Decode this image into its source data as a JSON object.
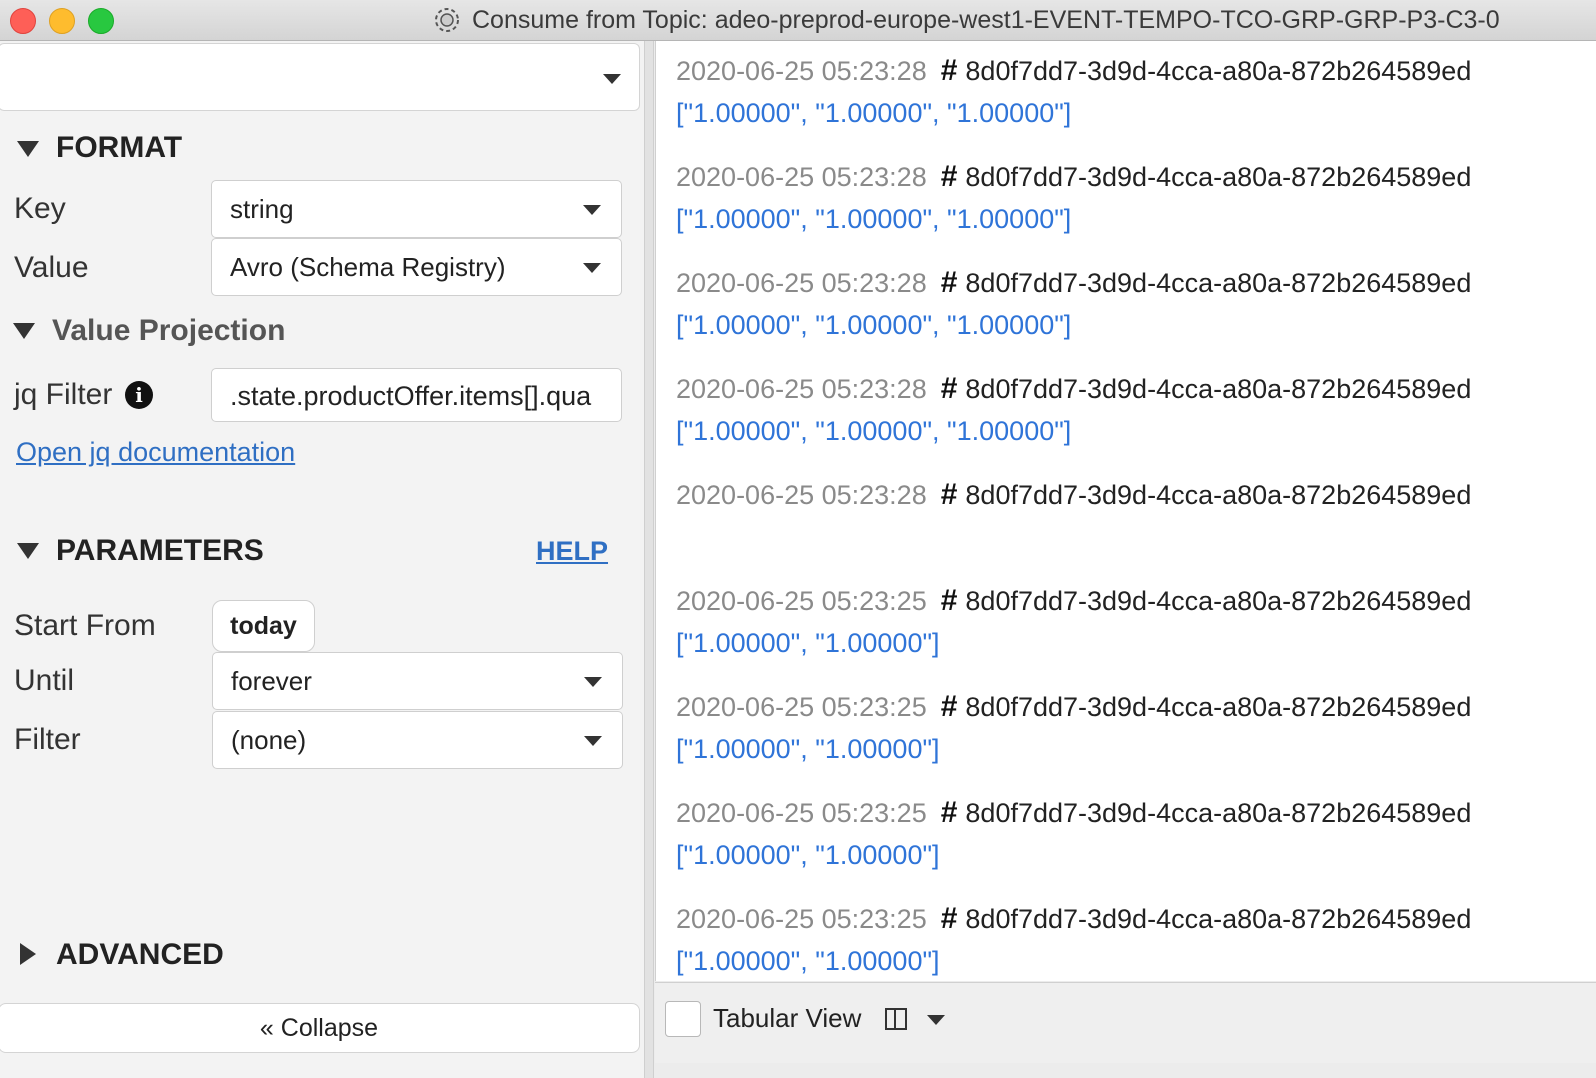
{
  "window": {
    "title": "Consume from  Topic: adeo-preprod-europe-west1-EVENT-TEMPO-TCO-GRP-GRP-P3-C3-0"
  },
  "format": {
    "heading": "FORMAT",
    "key_label": "Key",
    "key_value": "string",
    "value_label": "Value",
    "value_value": "Avro (Schema Registry)"
  },
  "projection": {
    "heading": "Value Projection",
    "jq_label": "jq Filter",
    "jq_value": ".state.productOffer.items[].qua",
    "doc_link": "Open jq documentation"
  },
  "parameters": {
    "heading": "PARAMETERS",
    "help": "HELP",
    "start_label": "Start From",
    "start_value": "today",
    "until_label": "Until",
    "until_value": "forever",
    "filter_label": "Filter",
    "filter_value": "(none)"
  },
  "advanced": {
    "heading": "ADVANCED"
  },
  "collapse_label": "« Collapse",
  "messages": [
    {
      "ts": "2020-06-25 05:23:28",
      "id": "8d0f7dd7-3d9d-4cca-a80a-872b264589ed",
      "value": "[\"1.00000\", \"1.00000\", \"1.00000\"]"
    },
    {
      "ts": "2020-06-25 05:23:28",
      "id": "8d0f7dd7-3d9d-4cca-a80a-872b264589ed",
      "value": "[\"1.00000\", \"1.00000\", \"1.00000\"]"
    },
    {
      "ts": "2020-06-25 05:23:28",
      "id": "8d0f7dd7-3d9d-4cca-a80a-872b264589ed",
      "value": "[\"1.00000\", \"1.00000\", \"1.00000\"]"
    },
    {
      "ts": "2020-06-25 05:23:28",
      "id": "8d0f7dd7-3d9d-4cca-a80a-872b264589ed",
      "value": "[\"1.00000\", \"1.00000\", \"1.00000\"]"
    },
    {
      "ts": "2020-06-25 05:23:28",
      "id": "8d0f7dd7-3d9d-4cca-a80a-872b264589ed",
      "value": ""
    },
    {
      "ts": "2020-06-25 05:23:25",
      "id": "8d0f7dd7-3d9d-4cca-a80a-872b264589ed",
      "value": "[\"1.00000\", \"1.00000\"]"
    },
    {
      "ts": "2020-06-25 05:23:25",
      "id": "8d0f7dd7-3d9d-4cca-a80a-872b264589ed",
      "value": "[\"1.00000\", \"1.00000\"]"
    },
    {
      "ts": "2020-06-25 05:23:25",
      "id": "8d0f7dd7-3d9d-4cca-a80a-872b264589ed",
      "value": "[\"1.00000\", \"1.00000\"]"
    },
    {
      "ts": "2020-06-25 05:23:25",
      "id": "8d0f7dd7-3d9d-4cca-a80a-872b264589ed",
      "value": "[\"1.00000\", \"1.00000\"]"
    }
  ],
  "message_hash": "#",
  "bottom": {
    "tabular_label": "Tabular View"
  },
  "colors": {
    "timestamp": "#8a8a8a",
    "value": "#2f74d8",
    "link": "#2f6fc3"
  }
}
